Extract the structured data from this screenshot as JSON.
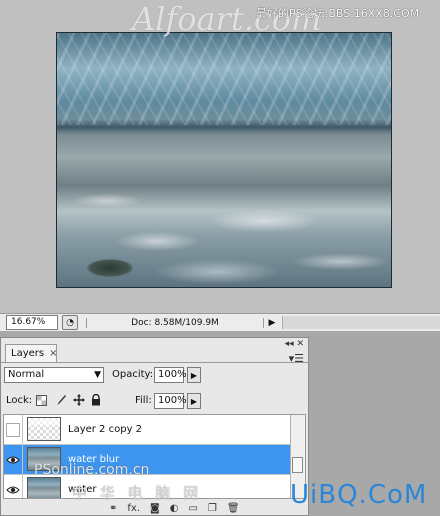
{
  "canvas": {
    "watermark_title": "Alfoart.com",
    "watermark_forum": "最好的PS论坛:BBS.16XX8.COM"
  },
  "status_bar": {
    "zoom": "16.67%",
    "doc_info": "Doc: 8.58M/109.9M"
  },
  "layers_panel": {
    "topbar": "◂◂ ✕",
    "tab_label": "Layers",
    "tab_close": "×",
    "blend_mode": "Normal",
    "opacity_label": "Opacity:",
    "opacity_value": "100%",
    "lock_label": "Lock:",
    "fill_label": "Fill:",
    "fill_value": "100%",
    "layers": [
      {
        "name": "Layer 2 copy 2",
        "visible": false,
        "selected": false
      },
      {
        "name": "water blur",
        "visible": true,
        "selected": true
      },
      {
        "name": "water",
        "visible": true,
        "selected": false
      }
    ],
    "footer_icons": [
      "link-icon",
      "fx-icon",
      "mask-icon",
      "adjustment-icon",
      "group-icon",
      "new-layer-icon",
      "trash-icon"
    ],
    "footer_fx": "fx."
  },
  "watermarks": {
    "psonline": "PSonline.com.cn",
    "chinese": "中 华 电 脑 网",
    "uibq": "UiBQ.CoM"
  },
  "colors": {
    "selection": "#3d95f0",
    "canvas_bg": "#c0c0c0",
    "uibq_blue": "#2b86d8"
  }
}
